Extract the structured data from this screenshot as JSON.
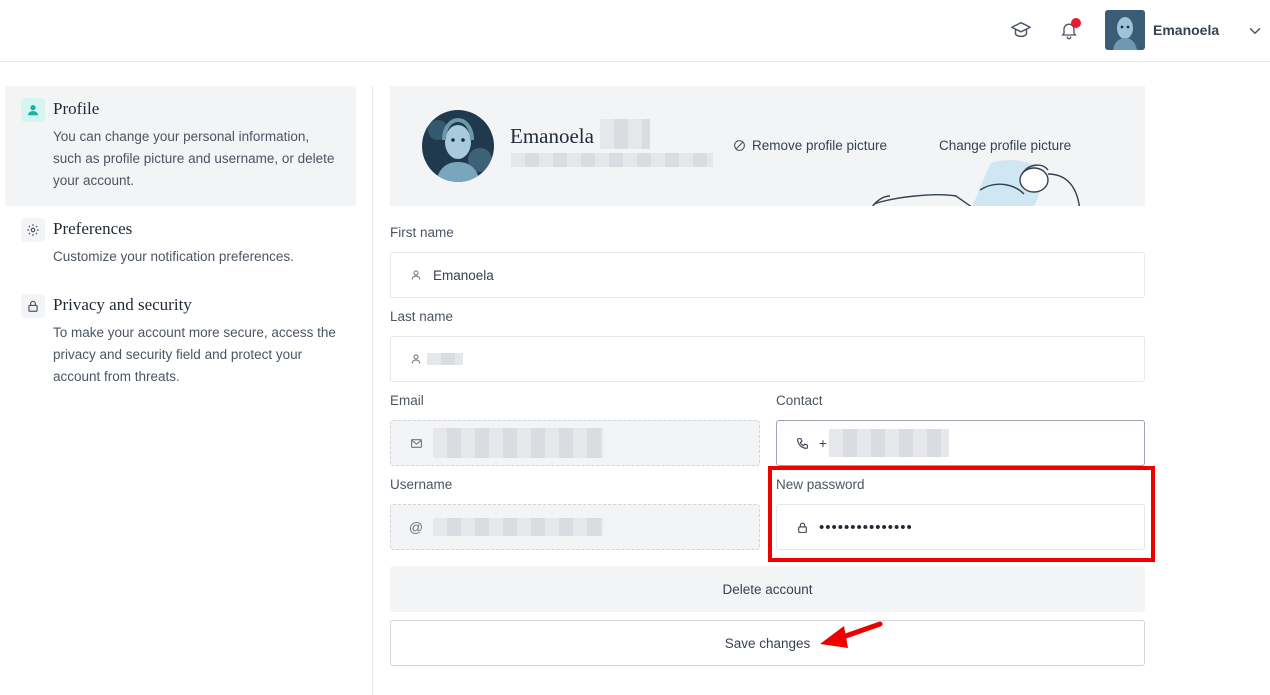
{
  "header": {
    "learn_icon": "graduation-cap-icon",
    "notification_icon": "bell-icon",
    "user_name": "Emanoela",
    "menu_icon": "chevron-down-icon"
  },
  "sidebar": {
    "items": [
      {
        "title": "Profile",
        "description": "You can change your personal information, such as profile picture and username, or delete your account.",
        "icon": "user-icon",
        "active": true
      },
      {
        "title": "Preferences",
        "description": "Customize your notification preferences.",
        "icon": "gear-icon",
        "active": false
      },
      {
        "title": "Privacy and security",
        "description": "To make your account more secure, access the privacy and security field and protect your account from threats.",
        "icon": "lock-icon",
        "active": false
      }
    ]
  },
  "profile": {
    "name": "Emanoela",
    "remove_picture_label": "Remove profile picture",
    "change_picture_label": "Change profile picture"
  },
  "form": {
    "first_name": {
      "label": "First name",
      "value": "Emanoela"
    },
    "last_name": {
      "label": "Last name",
      "value": ""
    },
    "email": {
      "label": "Email",
      "value": ""
    },
    "contact": {
      "label": "Contact",
      "value": "+"
    },
    "username": {
      "label": "Username",
      "prefix": "@",
      "value": ""
    },
    "new_password": {
      "label": "New password",
      "value": "•••••••••••••••"
    }
  },
  "actions": {
    "delete_label": "Delete account",
    "save_label": "Save changes"
  },
  "colors": {
    "accent": "#19b3a1",
    "notification_dot": "#e11d2e",
    "annotation_red": "#ee0000",
    "panel_bg": "#f3f4f6"
  }
}
